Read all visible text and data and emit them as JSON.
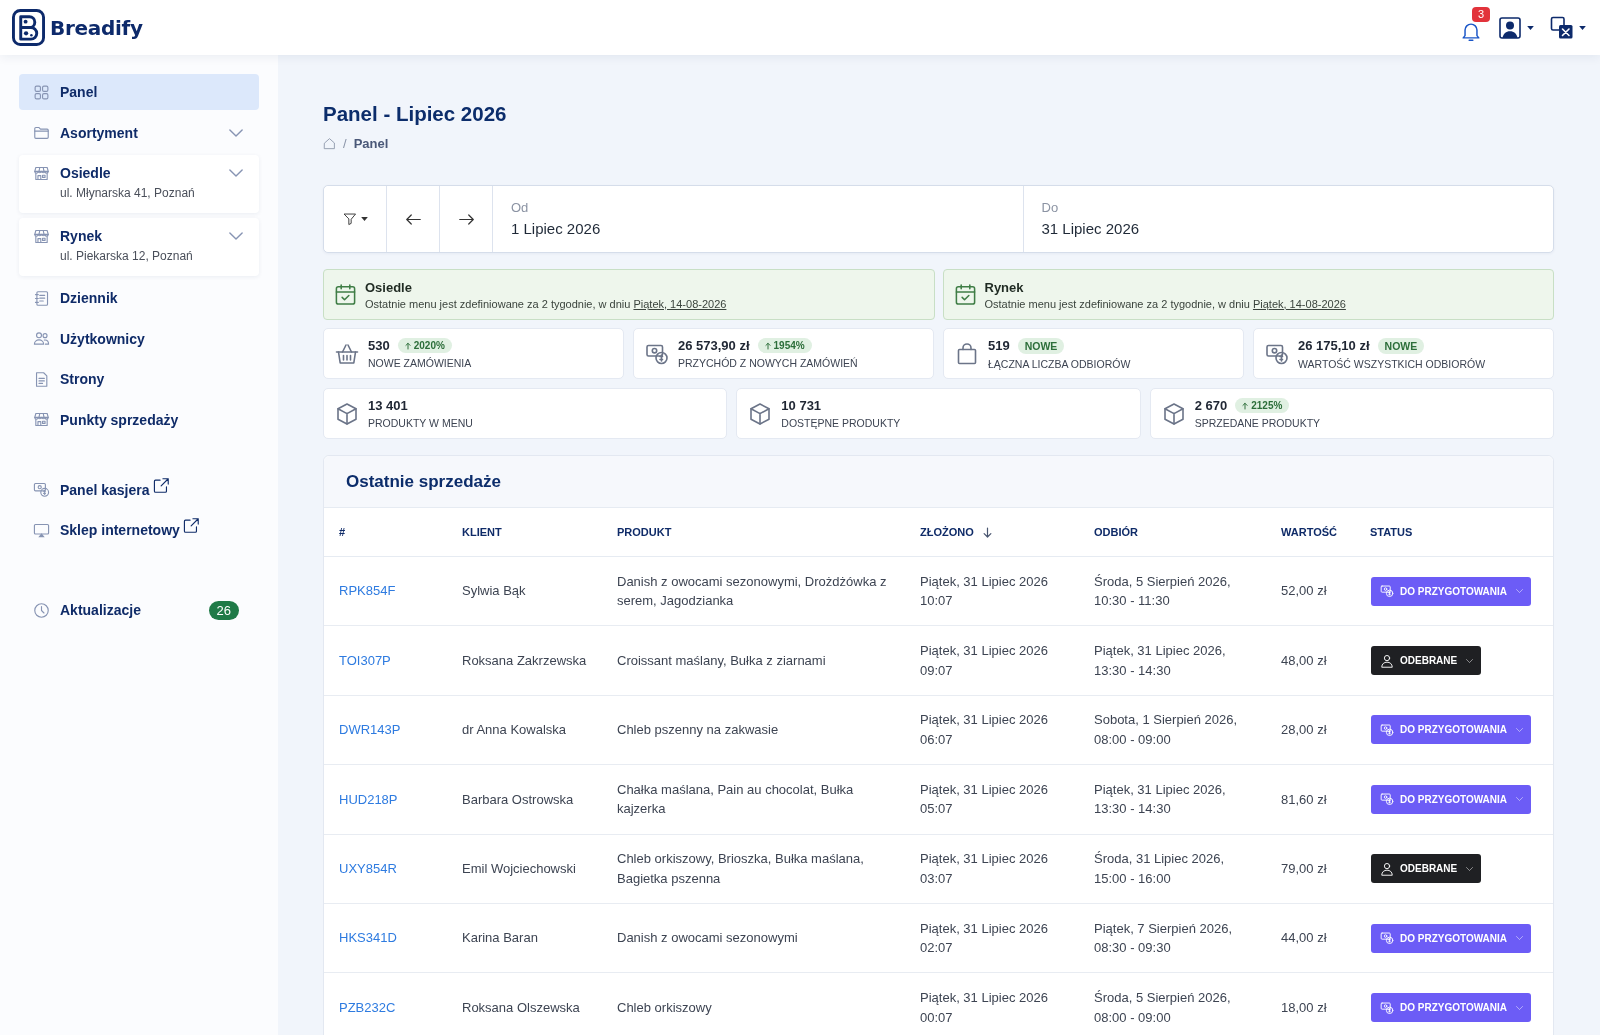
{
  "header": {
    "logo": "Breadify",
    "notifications": "3"
  },
  "sidebar": {
    "sections": [
      {
        "items": [
          {
            "kind": "link",
            "label": "Panel",
            "selected": true
          },
          {
            "kind": "group",
            "label": "Asortyment",
            "selected": false,
            "expanded": false
          },
          {
            "kind": "location",
            "label": "Osiedle",
            "address": "ul. Młynarska 41, Poznań",
            "selected": false,
            "expanded": false
          },
          {
            "kind": "location",
            "label": "Rynek",
            "address": "ul. Piekarska 12, Poznań",
            "selected": false,
            "expanded": false
          },
          {
            "kind": "link",
            "label": "Dziennik",
            "selected": false
          },
          {
            "kind": "link",
            "label": "Użytkownicy",
            "selected": false
          },
          {
            "kind": "link",
            "label": "Strony",
            "selected": false
          },
          {
            "kind": "link",
            "label": "Punkty sprzedaży",
            "selected": false
          }
        ]
      },
      {
        "items": [
          {
            "kind": "external",
            "label": "Panel kasjera",
            "selected": false
          },
          {
            "kind": "external",
            "label": "Sklep internetowy",
            "selected": false
          }
        ]
      },
      {
        "items": [
          {
            "kind": "link",
            "label": "Aktualizacje",
            "selected": false,
            "badge": "26"
          }
        ]
      }
    ]
  },
  "page": {
    "title": "Panel - Lipiec 2026",
    "breadcrumb": {
      "separator": "/",
      "items": [
        "Panel"
      ]
    }
  },
  "date_range": {
    "fields": [
      {
        "label": "Od",
        "value": "1 Lipiec 2026"
      },
      {
        "label": "Do",
        "value": "31 Lipiec 2026"
      }
    ]
  },
  "alerts": [
    {
      "title": "Osiedle",
      "text": "Ostatnie menu jest zdefiniowane za 2 tygodnie, w dniu",
      "link": "Piątek, 14-08-2026"
    },
    {
      "title": "Rynek",
      "text": "Ostatnie menu jest zdefiniowane za 2 tygodnie, w dniu",
      "link": "Piątek, 14-08-2026"
    }
  ],
  "stats": [
    {
      "cards": [
        {
          "value": "530",
          "badge": {
            "kind": "increase",
            "text": "2020%"
          },
          "label": "NOWE ZAMÓWIENIA"
        },
        {
          "value": "26 573,90 zł",
          "badge": {
            "kind": "increase",
            "text": "1954%"
          },
          "label": "PRZYCHÓD Z NOWYCH ZAMÓWIEŃ"
        },
        {
          "value": "519",
          "badge": {
            "kind": "new",
            "text": "NOWE"
          },
          "label": "ŁĄCZNA LICZBA ODBIORÓW"
        },
        {
          "value": "26 175,10 zł",
          "badge": {
            "kind": "new",
            "text": "NOWE"
          },
          "label": "WARTOŚĆ WSZYSTKICH ODBIORÓW"
        }
      ]
    },
    {
      "cards": [
        {
          "value": "13 401",
          "label": "PRODUKTY W MENU"
        },
        {
          "value": "10 731",
          "label": "DOSTĘPNE PRODUKTY"
        },
        {
          "value": "2 670",
          "badge": {
            "kind": "increase",
            "text": "2125%"
          },
          "label": "SPRZEDANE PRODUKTY"
        }
      ]
    }
  ],
  "sales": {
    "title": "Ostatnie sprzedaże",
    "columns": [
      {
        "label": "#",
        "sorted": false
      },
      {
        "label": "KLIENT",
        "sorted": false
      },
      {
        "label": "PRODUKT",
        "sorted": false
      },
      {
        "label": "ZŁOŻONO",
        "sorted": true
      },
      {
        "label": "ODBIÓR",
        "sorted": false
      },
      {
        "label": "WARTOŚĆ",
        "sorted": false
      },
      {
        "label": "STATUS",
        "sorted": false
      }
    ],
    "rows": [
      {
        "id": "RPK854F",
        "client": "Sylwia Bąk",
        "product": "Danish z owocami sezonowymi, Drożdżówka z serem, Jagodzianka",
        "placed": "Piątek, 31 Lipiec 2026 10:07",
        "pickup": "Środa, 5 Sierpień 2026, 10:30 - 11:30",
        "value": "52,00 zł",
        "status": {
          "kind": "pending",
          "label": "DO PRZYGOTOWANIA"
        }
      },
      {
        "id": "TOI307P",
        "client": "Roksana Zakrzewska",
        "product": "Croissant maślany, Bułka z ziarnami",
        "placed": "Piątek, 31 Lipiec 2026 09:07",
        "pickup": "Piątek, 31 Lipiec 2026, 13:30 - 14:30",
        "value": "48,00 zł",
        "status": {
          "kind": "picked_up",
          "label": "ODEBRANE"
        }
      },
      {
        "id": "DWR143P",
        "client": "dr Anna Kowalska",
        "product": "Chleb pszenny na zakwasie",
        "placed": "Piątek, 31 Lipiec 2026 06:07",
        "pickup": "Sobota, 1 Sierpień 2026, 08:00 - 09:00",
        "value": "28,00 zł",
        "status": {
          "kind": "pending",
          "label": "DO PRZYGOTOWANIA"
        }
      },
      {
        "id": "HUD218P",
        "client": "Barbara Ostrowska",
        "product": "Chałka maślana, Pain au chocolat, Bułka kajzerka",
        "placed": "Piątek, 31 Lipiec 2026 05:07",
        "pickup": "Piątek, 31 Lipiec 2026, 13:30 - 14:30",
        "value": "81,60 zł",
        "status": {
          "kind": "pending",
          "label": "DO PRZYGOTOWANIA"
        }
      },
      {
        "id": "UXY854R",
        "client": "Emil Wojciechowski",
        "product": "Chleb orkiszowy, Brioszka, Bułka maślana, Bagietka pszenna",
        "placed": "Piątek, 31 Lipiec 2026 03:07",
        "pickup": "Środa, 31 Lipiec 2026, 15:00 - 16:00",
        "value": "79,00 zł",
        "status": {
          "kind": "picked_up",
          "label": "ODEBRANE"
        }
      },
      {
        "id": "HKS341D",
        "client": "Karina Baran",
        "product": "Danish z owocami sezonowymi",
        "placed": "Piątek, 31 Lipiec 2026 02:07",
        "pickup": "Piątek, 7 Sierpień 2026, 08:30 - 09:30",
        "value": "44,00 zł",
        "status": {
          "kind": "pending",
          "label": "DO PRZYGOTOWANIA"
        }
      },
      {
        "id": "PZB232C",
        "client": "Roksana Olszewska",
        "product": "Chleb orkiszowy",
        "placed": "Piątek, 31 Lipiec 2026 00:07",
        "pickup": "Środa, 5 Sierpień 2026, 08:00 - 09:00",
        "value": "18,00 zł",
        "status": {
          "kind": "pending",
          "label": "DO PRZYGOTOWANIA"
        }
      }
    ]
  }
}
